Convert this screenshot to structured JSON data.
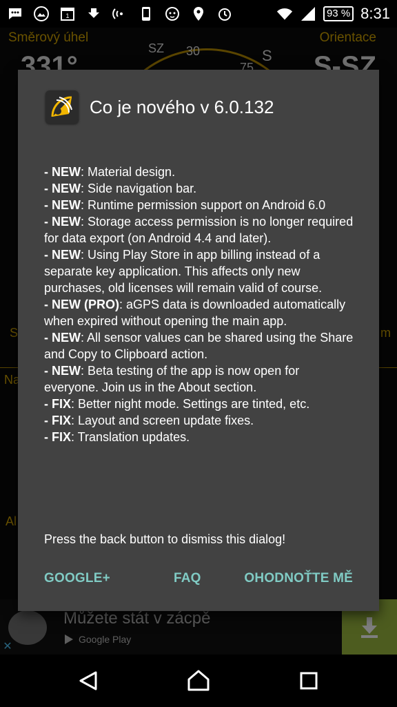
{
  "status_bar": {
    "battery": "93 %",
    "time": "8:31",
    "icons": [
      "message-icon",
      "gallery-icon",
      "calendar-icon",
      "download-icon",
      "signal-broadcast-icon",
      "phone-icon",
      "lion-icon",
      "location-icon",
      "alarm-icon",
      "wifi-icon",
      "cell-signal-icon"
    ]
  },
  "background": {
    "left_label": "Směrový úhel",
    "right_label": "Orientace",
    "left_value": "331°",
    "right_value": "S-SZ",
    "dial_labels": [
      "SZ",
      "30",
      "S",
      "75"
    ],
    "side_left_1": "S",
    "side_right_1": "m",
    "side_left_2": "Na",
    "side_left_3": "Al"
  },
  "dialog": {
    "title": "Co je nového v 6.0.132",
    "changes": [
      {
        "tag": "- NEW",
        "text": ": Material design."
      },
      {
        "tag": "- NEW",
        "text": ": Side navigation bar."
      },
      {
        "tag": "- NEW",
        "text": ": Runtime permission support on Android 6.0"
      },
      {
        "tag": "- NEW",
        "text": ": Storage access permission is no longer required for data export (on Android 4.4 and later)."
      },
      {
        "tag": "- NEW",
        "text": ": Using Play Store in app billing instead of a separate key application. This affects only new purchases, old licenses will remain valid of course."
      },
      {
        "tag": "- NEW (PRO)",
        "text": ": aGPS data is downloaded automatically when expired without opening the main app."
      },
      {
        "tag": "- NEW",
        "text": ": All sensor values can be shared using the Share and Copy to Clipboard action."
      },
      {
        "tag": "- NEW",
        "text": ": Beta testing of the app is now open for everyone. Join us in the About section."
      },
      {
        "tag": "- FIX",
        "text": ": Better night mode. Settings are tinted, etc."
      },
      {
        "tag": "- FIX",
        "text": ": Layout and screen update fixes."
      },
      {
        "tag": "- FIX",
        "text": ": Translation updates."
      }
    ],
    "footer": "Press the back button to dismiss this dialog!",
    "actions": {
      "google_plus": "GOOGLE+",
      "faq": "FAQ",
      "rate": "OHODNOŤTE MĚ"
    }
  },
  "ad": {
    "title": "Můžete stát v zácpě",
    "source": "Google Play"
  },
  "colors": {
    "accent": "#80cbc4",
    "dialog_bg": "#424242",
    "bg_label": "#d3a400",
    "ad_download": "#9bb83f"
  }
}
